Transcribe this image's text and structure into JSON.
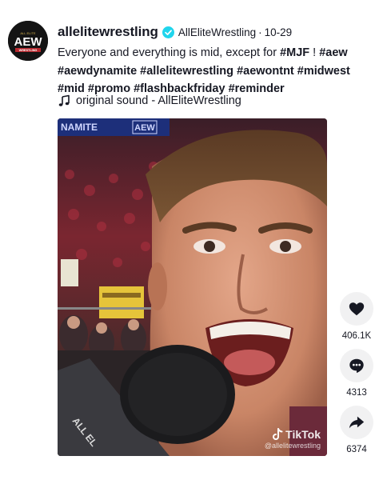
{
  "post": {
    "username": "allelitewrestling",
    "nickname": "AllEliteWrestling",
    "separator": "·",
    "date": "10-29",
    "caption_parts": [
      {
        "text": "Everyone and everything is mid, except for ",
        "tag": false
      },
      {
        "text": "#MJF",
        "tag": true
      },
      {
        "text": " ! ",
        "tag": false
      },
      {
        "text": "#aew",
        "tag": true
      },
      {
        "text": " ",
        "tag": false
      },
      {
        "text": "#aewdynamite",
        "tag": true
      },
      {
        "text": " ",
        "tag": false
      },
      {
        "text": "#allelitewrestling",
        "tag": true
      },
      {
        "text": " ",
        "tag": false
      },
      {
        "text": "#aewontnt",
        "tag": true
      },
      {
        "text": " ",
        "tag": false
      },
      {
        "text": "#midwest",
        "tag": true
      },
      {
        "text": " ",
        "tag": false
      },
      {
        "text": "#mid",
        "tag": true
      },
      {
        "text": " ",
        "tag": false
      },
      {
        "text": "#promo",
        "tag": true
      },
      {
        "text": " ",
        "tag": false
      },
      {
        "text": "#flashbackfriday",
        "tag": true
      },
      {
        "text": " ",
        "tag": false
      },
      {
        "text": "#reminder",
        "tag": true
      }
    ],
    "sound": "original sound - AllEliteWrestling"
  },
  "avatar": {
    "logo_text": "AEW",
    "small_top": "ALL ELITE",
    "small_bottom": "WRESTLING"
  },
  "video": {
    "watermark_brand": "TikTok",
    "watermark_handle": "@allelitewrestling",
    "banner_text": "AEW",
    "banner_partial": "NAMITE",
    "mic_flag_text": "ALL EL"
  },
  "actions": {
    "likes": "406.1K",
    "comments": "4313",
    "shares": "6374"
  },
  "icons": {
    "verified": "verified-badge-icon",
    "sound": "music-note-icon",
    "like": "heart-icon",
    "comment": "comment-bubble-icon",
    "share": "share-arrow-icon"
  },
  "colors": {
    "text": "#161823",
    "verified": "#20d5ec",
    "action_bg": "#f1f1f2"
  }
}
